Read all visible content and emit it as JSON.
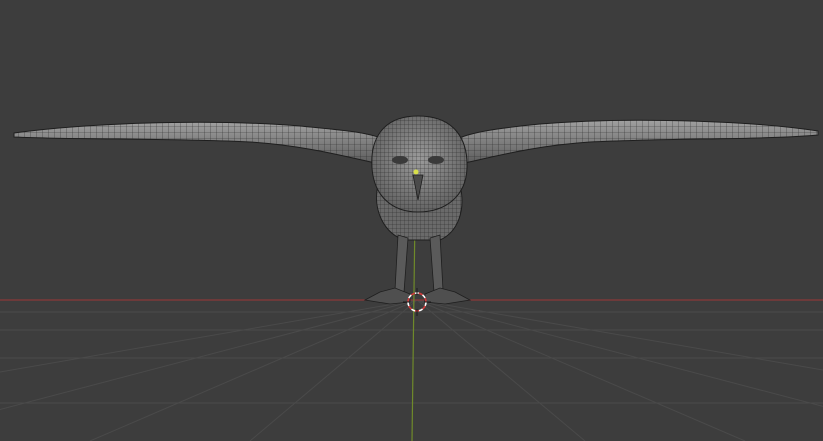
{
  "viewport": {
    "view": "front-orthographic",
    "background_color": "#3d3d3d",
    "grid_color": "#4a4a4a",
    "x_axis_color": "#8a3a3a",
    "z_axis_color": "#6f8a2a"
  },
  "model": {
    "subject": "owl",
    "display": "wireframe-on-shaded",
    "mesh_color": "#8c8c8c",
    "wire_color": "#1e1e1e",
    "origin_color": "#d8e04a"
  },
  "cursor_3d": {
    "icon": "3d-cursor-icon",
    "ring_color_a": "#ffffff",
    "ring_color_b": "#d23b3b"
  }
}
